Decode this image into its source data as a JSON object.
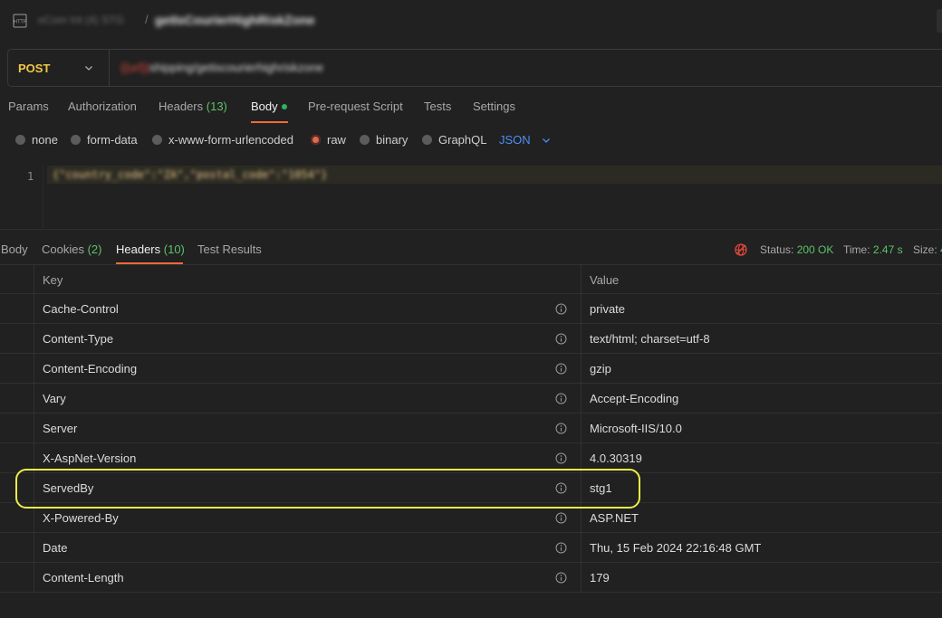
{
  "titlebar": {
    "icon": "http-icon",
    "crumb_prefix": "eCom Int (4) STG",
    "separator": "/",
    "request_name": "getIsCourierHighRiskZone"
  },
  "request": {
    "method": "POST",
    "url_variable": "{{url}}",
    "url_path": "shipping/getiscourierhighriskzone"
  },
  "request_tabs": [
    {
      "label": "Params"
    },
    {
      "label": "Authorization"
    },
    {
      "label": "Headers",
      "count": "(13)"
    },
    {
      "label": "Body",
      "active": true
    },
    {
      "label": "Pre-request Script"
    },
    {
      "label": "Tests"
    },
    {
      "label": "Settings"
    }
  ],
  "body_types": {
    "options": [
      "none",
      "form-data",
      "x-www-form-urlencoded",
      "raw",
      "binary",
      "GraphQL"
    ],
    "selected": "raw",
    "format": "JSON"
  },
  "editor": {
    "line_number": "1",
    "code": "{\"country_code\":\"ZA\",\"postal_code\":\"1054\"}"
  },
  "response_tabs": [
    {
      "label": "Body"
    },
    {
      "label": "Cookies",
      "count": "(2)"
    },
    {
      "label": "Headers",
      "count": "(10)",
      "active": true
    },
    {
      "label": "Test Results"
    }
  ],
  "response_status": {
    "status_label": "Status:",
    "status_value": "200 OK",
    "time_label": "Time:",
    "time_value": "2.47 s",
    "size_label": "Size:",
    "size_value": "4"
  },
  "headers_table": {
    "columns": {
      "key": "Key",
      "value": "Value"
    },
    "rows": [
      {
        "key": "Cache-Control",
        "value": "private"
      },
      {
        "key": "Content-Type",
        "value": "text/html; charset=utf-8"
      },
      {
        "key": "Content-Encoding",
        "value": "gzip"
      },
      {
        "key": "Vary",
        "value": "Accept-Encoding"
      },
      {
        "key": "Server",
        "value": "Microsoft-IIS/10.0"
      },
      {
        "key": "X-AspNet-Version",
        "value": "4.0.30319"
      },
      {
        "key": "ServedBy",
        "value": "stg1"
      },
      {
        "key": "X-Powered-By",
        "value": "ASP.NET"
      },
      {
        "key": "Date",
        "value": "Thu, 15 Feb 2024 22:16:48 GMT"
      },
      {
        "key": "Content-Length",
        "value": "179"
      }
    ]
  },
  "colors": {
    "method": "#f0c746",
    "active_tab_underline": "#f26b3a",
    "count_green": "#5ec26a",
    "json_link": "#4d8ff5",
    "highlight_box": "#eeee4a"
  }
}
